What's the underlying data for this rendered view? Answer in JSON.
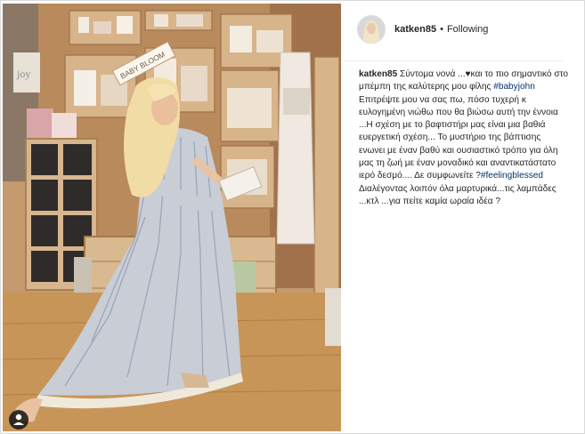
{
  "post": {
    "username": "katken85",
    "separator": "•",
    "follow_status": "Following"
  },
  "caption": {
    "username": "katken85",
    "line1": "Σύντομα νονά ...",
    "heart": "♥",
    "line1b": "και το πιο σημαντικό στο μπέμπη της καλύτερης μου φίλης ",
    "hashtag1": "#babyjohn",
    "line2": "Επιτρέψτε μου να σας πω, πόσο τυχερή κ ευλογημένη νιώθω που θα βιώσω αυτή την έννοια ...Η σχέση με το βαφτιστήρι μας είναι μια βαθιά ευεργετική σχέση... Το μυστήριο της βάπτισης ενωνει με έναν βαθύ και ουσιαστικό τρόπο για όλη μας τη ζωή με έναν μοναδικό και αναντικατάστατο ιερό δεσμό.... Δε συμφωνείτε ?",
    "hashtag2": "#feelingblessed",
    "line3": "Διαλέγοντας λοιπόν όλα μαρτυρικά...τις λαμπάδες ...κτλ ...για πείτε καμία ωραία ιδέα ?"
  },
  "photo": {
    "sign_left": "joy",
    "sign_baby": "BABY BLOOM"
  },
  "icons": {
    "tag": "person-tag-icon",
    "avatar": "avatar"
  }
}
